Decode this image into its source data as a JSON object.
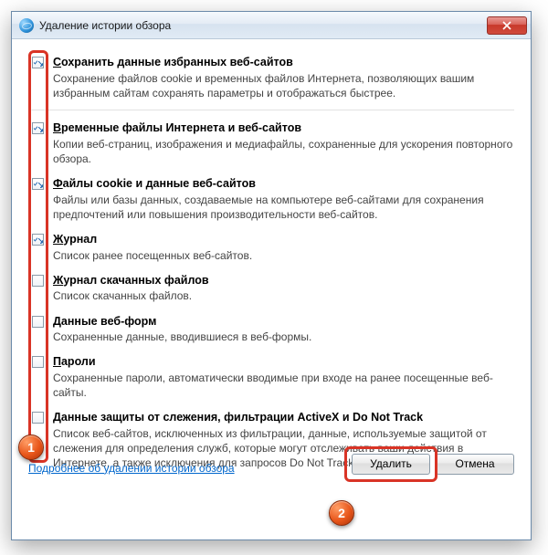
{
  "window": {
    "title": "Удаление истории обзора"
  },
  "items": [
    {
      "label_pre": "",
      "label_u": "С",
      "label_post": "охранить данные избранных веб-сайтов",
      "desc": "Сохранение файлов cookie и временных файлов Интернета, позволяющих вашим избранным сайтам сохранять параметры и отображаться быстрее.",
      "checked": true
    },
    {
      "label_pre": "",
      "label_u": "В",
      "label_post": "ременные файлы Интернета и веб-сайтов",
      "desc": "Копии веб-страниц, изображения и медиафайлы, сохраненные для ускорения повторного обзора.",
      "checked": true
    },
    {
      "label_pre": "",
      "label_u": "Ф",
      "label_post": "айлы cookie и данные веб-сайтов",
      "desc": "Файлы или базы данных, создаваемые на компьютере веб-сайтами для сохранения предпочтений или повышения производительности веб-сайтов.",
      "checked": true
    },
    {
      "label_pre": "",
      "label_u": "Ж",
      "label_post": "урнал",
      "desc": "Список ранее посещенных веб-сайтов.",
      "checked": true
    },
    {
      "label_pre": "",
      "label_u": "Ж",
      "label_post": "урнал скачанных файлов",
      "desc": "Список скачанных файлов.",
      "checked": false
    },
    {
      "label_pre": "",
      "label_u": "Д",
      "label_post": "анные веб-форм",
      "desc": "Сохраненные данные, вводившиеся в веб-формы.",
      "checked": false
    },
    {
      "label_pre": "",
      "label_u": "П",
      "label_post": "ароли",
      "desc": "Сохраненные пароли, автоматически вводимые при входе на ранее посещенные веб-сайты.",
      "checked": false
    },
    {
      "label_pre": "",
      "label_u": "Д",
      "label_post": "анные защиты от слежения, фильтрации ActiveX и Do Not Track",
      "desc": "Список веб-сайтов, исключенных из фильтрации, данные, используемые защитой от слежения для определения служб, которые могут отслеживать ваши действия в Интернете, а также исключения для запросов Do Not Track.",
      "checked": false
    }
  ],
  "footer": {
    "link": "Подробнее об удалении истории обзора",
    "delete": "Удалить",
    "cancel": "Отмена"
  },
  "markers": {
    "one": "1",
    "two": "2"
  }
}
